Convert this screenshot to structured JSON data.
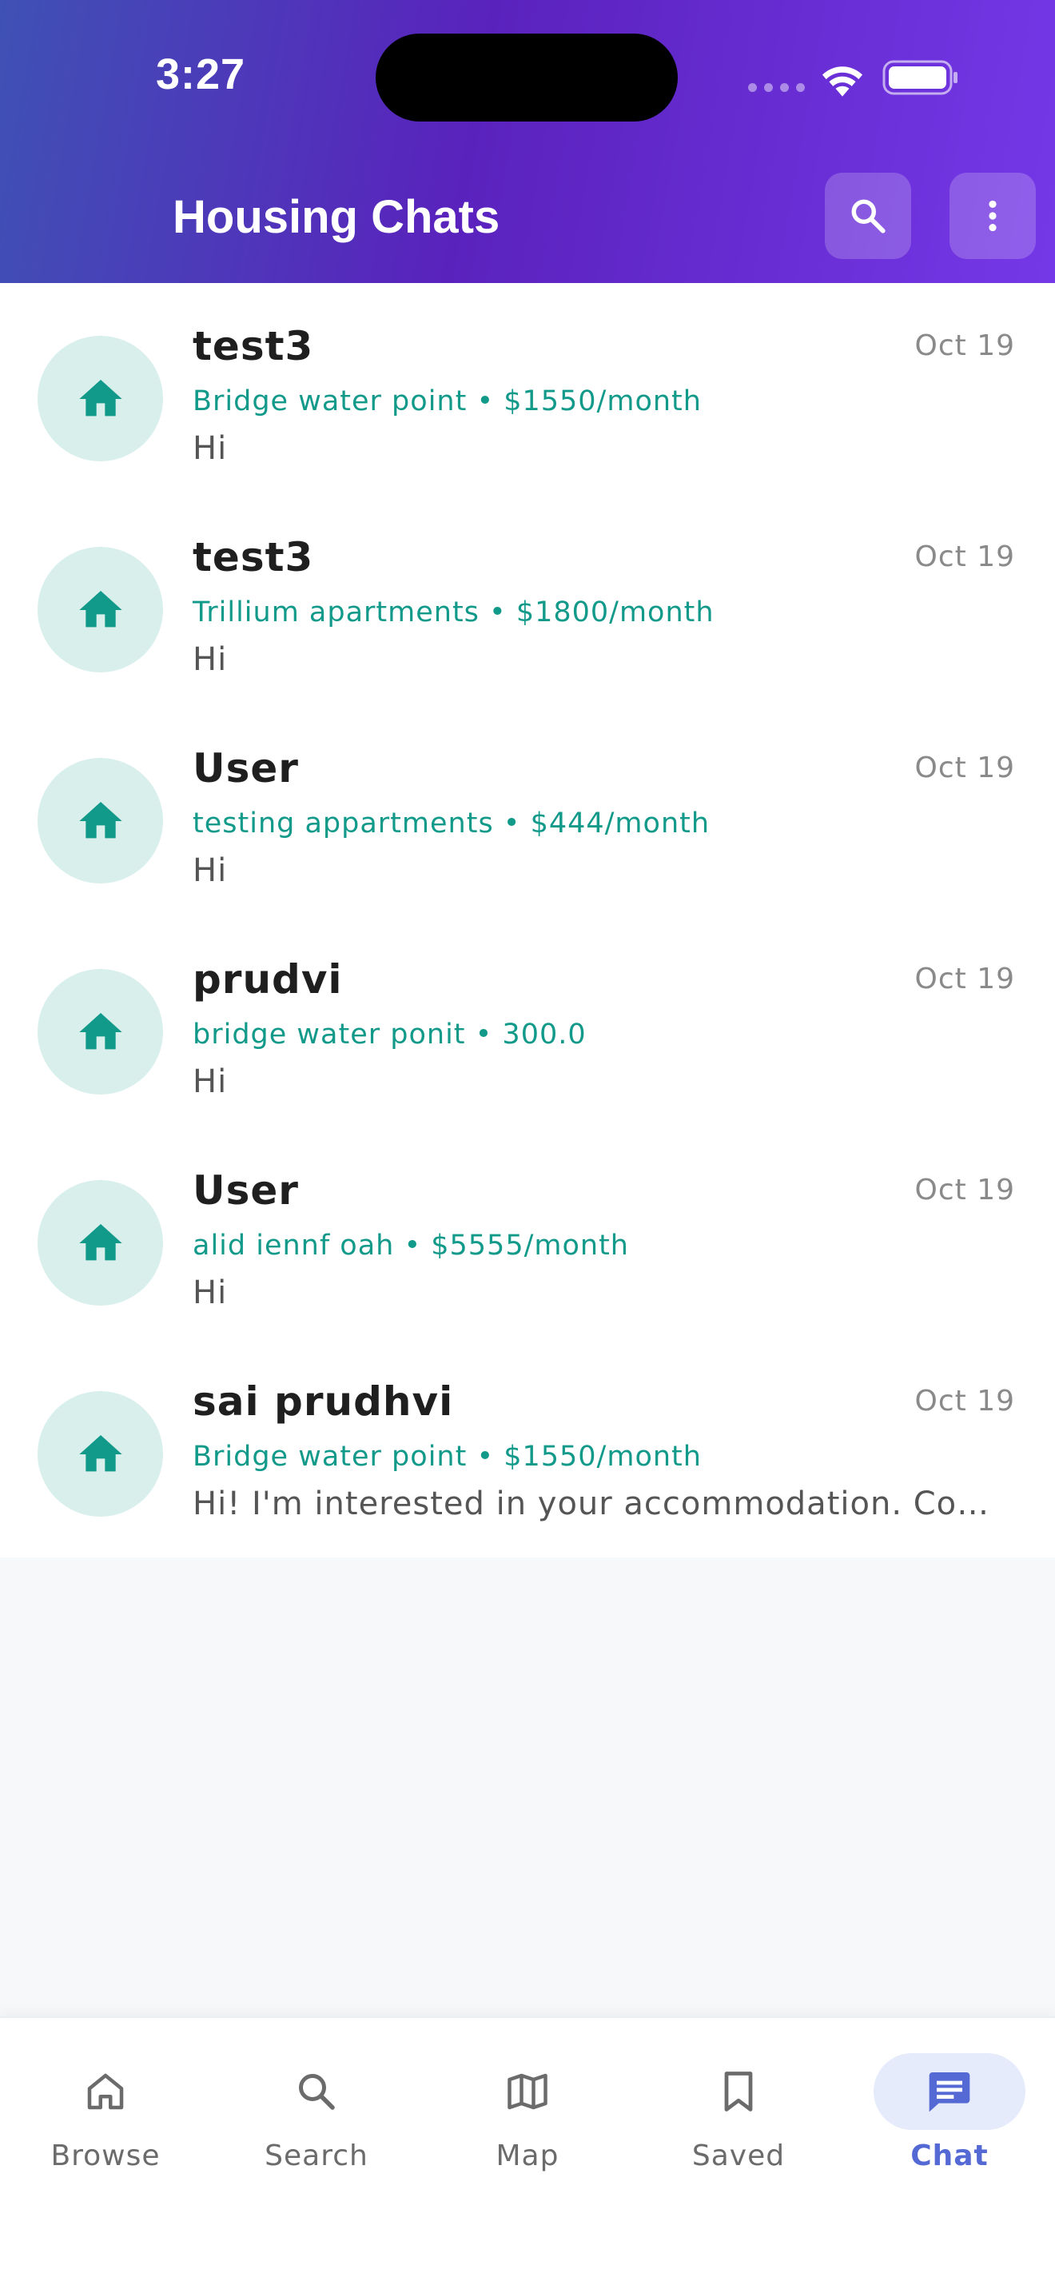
{
  "status_bar": {
    "time": "3:27"
  },
  "header": {
    "title": "Housing Chats",
    "search_icon": "search-icon",
    "more_icon": "more-vert-icon"
  },
  "chats": [
    {
      "name": "test3",
      "date": "Oct 19",
      "listing": "Bridge water point • $1550/month",
      "message": "Hi"
    },
    {
      "name": "test3",
      "date": "Oct 19",
      "listing": "Trillium apartments • $1800/month",
      "message": "Hi"
    },
    {
      "name": "User",
      "date": "Oct 19",
      "listing": "testing appartments • $444/month",
      "message": "Hi"
    },
    {
      "name": "prudvi",
      "date": "Oct 19",
      "listing": "bridge water ponit • 300.0",
      "message": "Hi"
    },
    {
      "name": "User",
      "date": "Oct 19",
      "listing": "alid iennf oah • $5555/month",
      "message": "Hi"
    },
    {
      "name": "sai prudhvi",
      "date": "Oct 19",
      "listing": "Bridge water point • $1550/month",
      "message": "Hi! I'm interested in your accommodation. Could..."
    }
  ],
  "nav": {
    "items": [
      {
        "label": "Browse",
        "icon": "home-icon"
      },
      {
        "label": "Search",
        "icon": "search-icon"
      },
      {
        "label": "Map",
        "icon": "map-icon"
      },
      {
        "label": "Saved",
        "icon": "bookmark-icon"
      },
      {
        "label": "Chat",
        "icon": "chat-icon"
      }
    ],
    "active": "Chat"
  },
  "colors": {
    "header_start": "#3f51b5",
    "header_end": "#7538e8",
    "accent_teal": "#11998a",
    "avatar_bg": "#d9efec",
    "nav_active": "#5469d4"
  }
}
